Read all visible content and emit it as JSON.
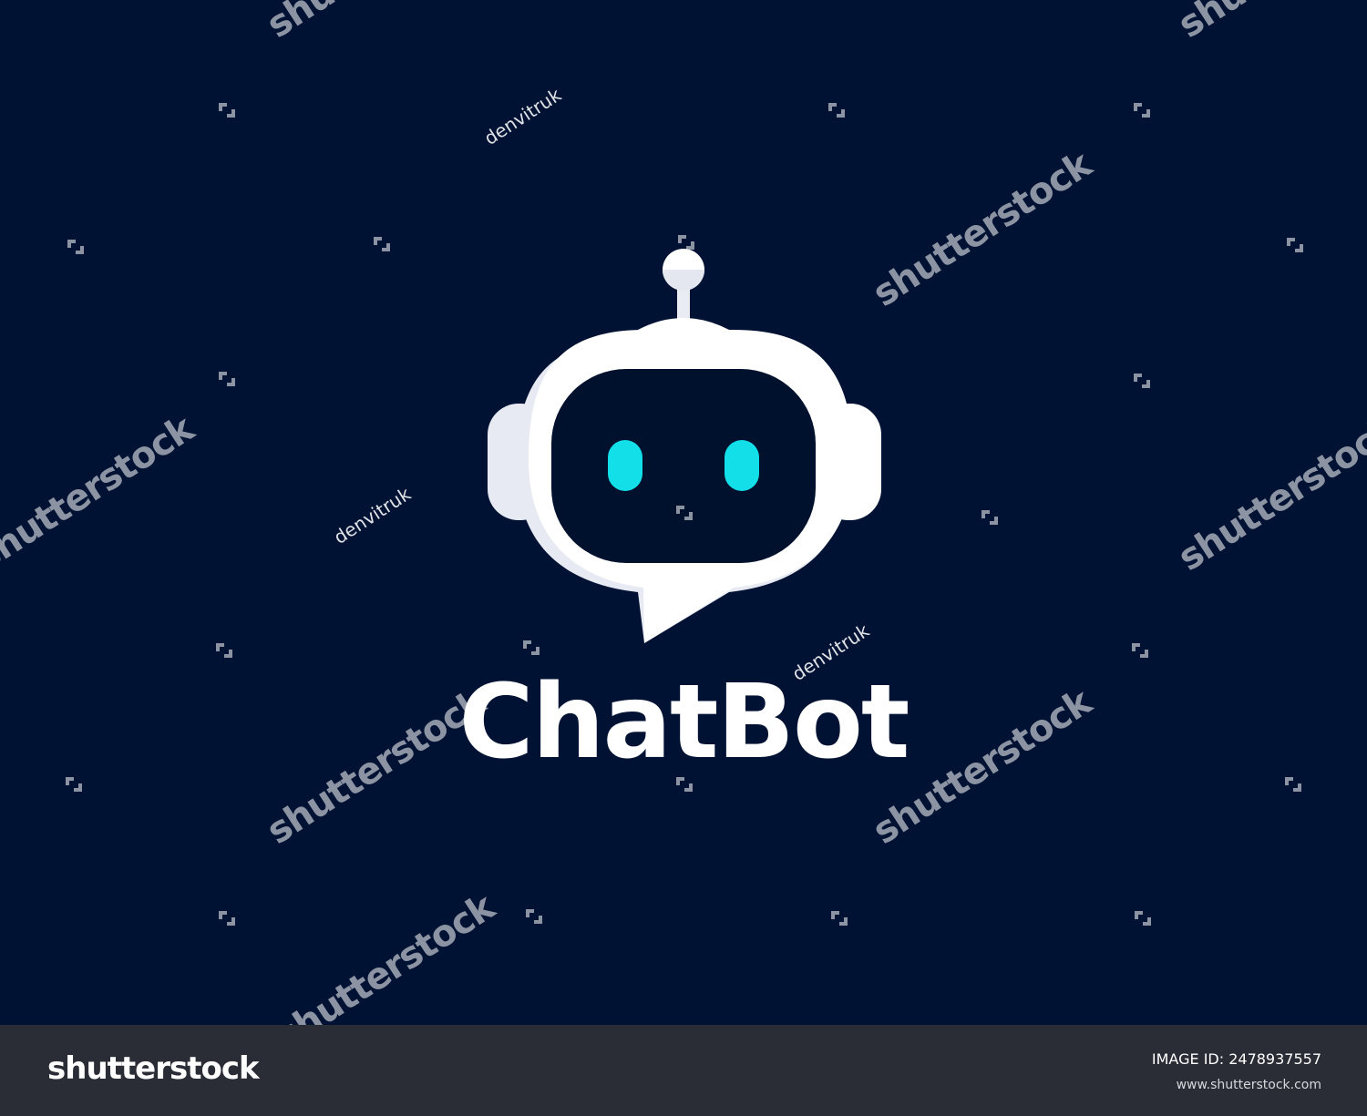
{
  "artwork": {
    "title": "ChatBot",
    "colors": {
      "background": "#001233",
      "head": "#ffffff",
      "head_shade": "#e7eaf2",
      "visor": "#00112e",
      "eyes": "#13dfe9"
    },
    "icon": "chatbot-robot-icon"
  },
  "watermark": {
    "text": "shutterstock",
    "author": "denvitruk",
    "icon": "shutterstock-logo-mark"
  },
  "footer": {
    "brand": "shutterstock",
    "image_id": "IMAGE ID: 2478937557",
    "site": "www.shutterstock.com"
  }
}
